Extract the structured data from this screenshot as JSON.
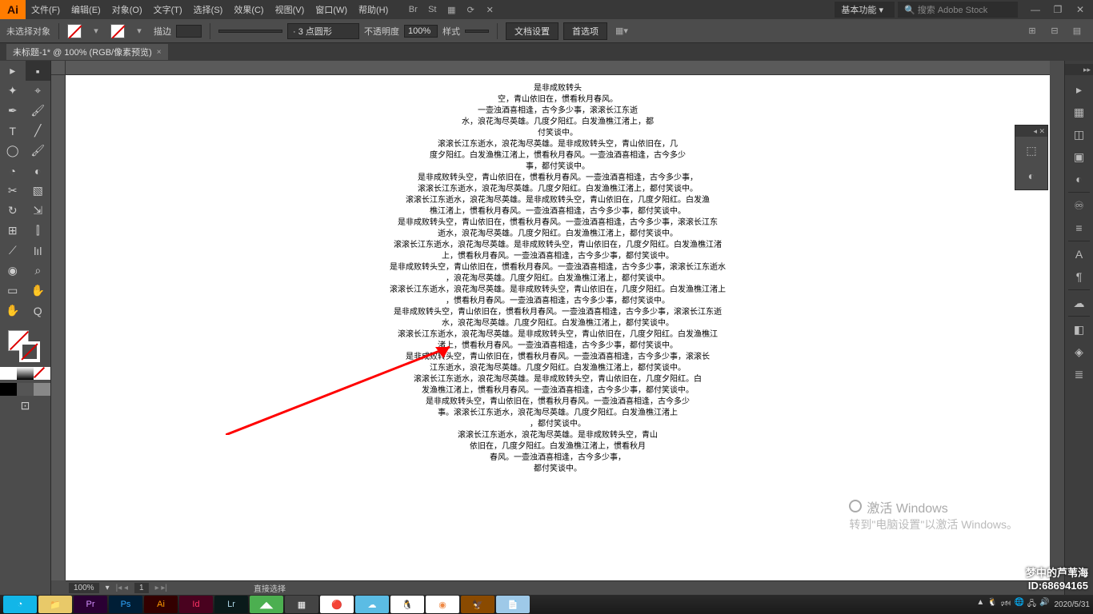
{
  "app": {
    "logo": "Ai"
  },
  "menu": [
    "文件(F)",
    "编辑(E)",
    "对象(O)",
    "文字(T)",
    "选择(S)",
    "效果(C)",
    "视图(V)",
    "窗口(W)",
    "帮助(H)"
  ],
  "menubar_icons": [
    "Br",
    "St",
    "▦",
    "⟳",
    "✕"
  ],
  "workspace_switcher": "基本功能",
  "search_placeholder": "搜索 Adobe Stock",
  "control": {
    "no_selection": "未选择对象",
    "stroke_label": "描边",
    "stroke_weight": "",
    "dash_label": "· 3 点圆形",
    "opacity_label": "不透明度",
    "opacity_value": "100%",
    "style_label": "样式",
    "doc_setup": "文档设置",
    "prefs": "首选项"
  },
  "tab": {
    "title": "未标题-1* @ 100% (RGB/像素预览)"
  },
  "tools_left": [
    [
      "▸",
      "▪"
    ],
    [
      "✦",
      "⌖"
    ],
    [
      "✒",
      "🖌"
    ],
    [
      "T",
      "╱"
    ],
    [
      "◯",
      "🖌"
    ],
    [
      "◔",
      "◐"
    ],
    [
      "✂",
      "▧"
    ],
    [
      "↻",
      "⇲"
    ],
    [
      "⊞",
      "⫿"
    ],
    [
      "⟋",
      "lıl"
    ],
    [
      "◉",
      "⌕"
    ],
    [
      "▭",
      "✋"
    ],
    [
      "✋",
      "Q"
    ]
  ],
  "text_lines": [
    "是非成败转头",
    "空，青山依旧在，惯看秋月春风。",
    "一壶浊酒喜相逢，古今多少事，滚滚长江东逝",
    "水，浪花淘尽英雄。几度夕阳红。白发渔樵江渚上，都",
    "付笑谈中。",
    "滚滚长江东逝水，浪花淘尽英雄。是非成败转头空，青山依旧在，几",
    "度夕阳红。白发渔樵江渚上，惯看秋月春风。一壶浊酒喜相逢，古今多少",
    "事，都付笑谈中。",
    "是非成败转头空，青山依旧在，惯看秋月春风。一壶浊酒喜相逢，古今多少事，",
    "滚滚长江东逝水，浪花淘尽英雄。几度夕阳红。白发渔樵江渚上，都付笑谈中。",
    "滚滚长江东逝水，浪花淘尽英雄。是非成败转头空，青山依旧在，几度夕阳红。白发渔",
    "樵江渚上，惯看秋月春风。一壶浊酒喜相逢，古今多少事，都付笑谈中。",
    "是非成败转头空，青山依旧在，惯看秋月春风。一壶浊酒喜相逢，古今多少事，滚滚长江东",
    "逝水，浪花淘尽英雄。几度夕阳红。白发渔樵江渚上，都付笑谈中。",
    "滚滚长江东逝水，浪花淘尽英雄。是非成败转头空，青山依旧在，几度夕阳红。白发渔樵江渚",
    "上，惯看秋月春风。一壶浊酒喜相逢，古今多少事，都付笑谈中。",
    "是非成败转头空，青山依旧在，惯看秋月春风。一壶浊酒喜相逢，古今多少事，滚滚长江东逝水",
    "，浪花淘尽英雄。几度夕阳红。白发渔樵江渚上，都付笑谈中。",
    "滚滚长江东逝水，浪花淘尽英雄。是非成败转头空，青山依旧在，几度夕阳红。白发渔樵江渚上",
    "，惯看秋月春风。一壶浊酒喜相逢，古今多少事，都付笑谈中。",
    "是非成败转头空，青山依旧在，惯看秋月春风。一壶浊酒喜相逢，古今多少事，滚滚长江东逝",
    "水，浪花淘尽英雄。几度夕阳红。白发渔樵江渚上，都付笑谈中。",
    "滚滚长江东逝水，浪花淘尽英雄。是非成败转头空，青山依旧在，几度夕阳红。白发渔樵江",
    "渚上，惯看秋月春风。一壶浊酒喜相逢，古今多少事，都付笑谈中。",
    "是非成败转头空，青山依旧在，惯看秋月春风。一壶浊酒喜相逢，古今多少事，滚滚长",
    "江东逝水，浪花淘尽英雄。几度夕阳红。白发渔樵江渚上，都付笑谈中。",
    "滚滚长江东逝水，浪花淘尽英雄。是非成败转头空，青山依旧在，几度夕阳红。白",
    "发渔樵江渚上，惯看秋月春风。一壶浊酒喜相逢，古今多少事，都付笑谈中。",
    "是非成败转头空，青山依旧在，惯看秋月春风。一壶浊酒喜相逢，古今多少",
    "事。滚滚长江东逝水，浪花淘尽英雄。几度夕阳红。白发渔樵江渚上",
    "，都付笑谈中。",
    "滚滚长江东逝水，浪花淘尽英雄。是非成败转头空，青山",
    "依旧在，几度夕阳红。白发渔樵江渚上，惯看秋月",
    "春风。一壶浊酒喜相逢，古今多少事，",
    "都付笑谈中。"
  ],
  "watermark": {
    "title": "激活 Windows",
    "subtitle": "转到\"电脑设置\"以激活 Windows。"
  },
  "status": {
    "zoom": "100%",
    "page_nav": "1",
    "tool_hint": "直接选择"
  },
  "right_dock": [
    "▸",
    "▦",
    "◫",
    "▣",
    "◐",
    "—",
    "♾",
    "≡",
    "—",
    "A",
    "¶",
    "—",
    "☁",
    "—",
    "◧",
    "◈",
    "≣"
  ],
  "float_icons": [
    "⬚",
    "◐"
  ],
  "taskbar": {
    "apps": [
      {
        "bg": "#12b6e8",
        "txt": "◔"
      },
      {
        "bg": "#e8c969",
        "txt": "📁"
      },
      {
        "bg": "#2a0033",
        "txt": "Pr",
        "fg": "#d490ff"
      },
      {
        "bg": "#001e36",
        "txt": "Ps",
        "fg": "#31a8ff"
      },
      {
        "bg": "#330000",
        "txt": "Ai",
        "fg": "#ff9a00"
      },
      {
        "bg": "#49021f",
        "txt": "Id",
        "fg": "#ff3366"
      },
      {
        "bg": "#0a1a1a",
        "txt": "Lr",
        "fg": "#aed7e8"
      },
      {
        "bg": "#4caf50",
        "txt": "◢◣"
      },
      {
        "bg": "#444",
        "txt": "▦"
      },
      {
        "bg": "#fff",
        "txt": "🔴",
        "fg": "#d00"
      },
      {
        "bg": "#5bbce4",
        "txt": "☁"
      },
      {
        "bg": "#fff",
        "txt": "🐧"
      },
      {
        "bg": "#fff",
        "txt": "◉",
        "fg": "#e84"
      },
      {
        "bg": "#8a4a00",
        "txt": "🦅"
      },
      {
        "bg": "#9ec9e8",
        "txt": "📄"
      }
    ],
    "tray": [
      "▲",
      "🐧",
      "🕬",
      "🌐",
      "🖧",
      "🔊"
    ],
    "date": "2020/5/31"
  },
  "overlay": {
    "line1": "梦中的芦苇海",
    "line2": "ID:68694165"
  }
}
